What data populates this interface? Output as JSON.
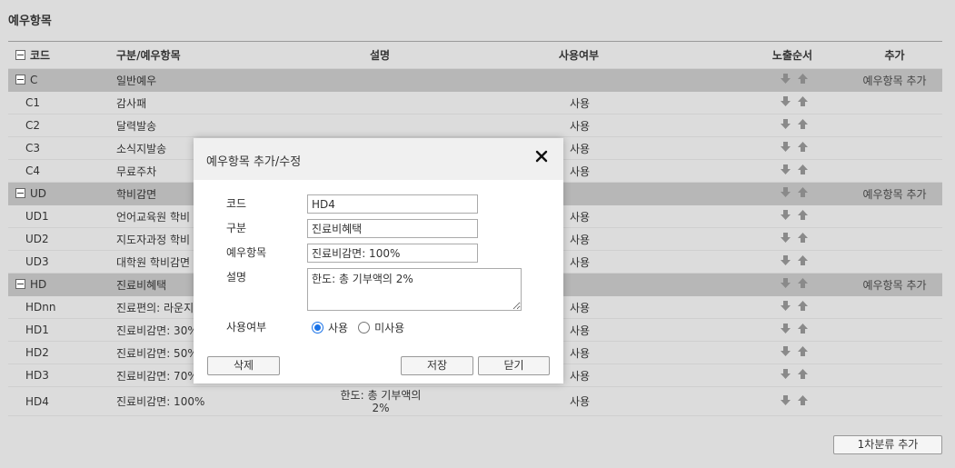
{
  "page": {
    "title": "예우항목"
  },
  "table": {
    "headers": {
      "code": "코드",
      "name": "구분/예우항목",
      "desc": "설명",
      "use": "사용여부",
      "order": "노출순서",
      "add": "추가"
    },
    "rows": [
      {
        "type": "group",
        "code": "C",
        "name": "일반예우",
        "desc": "",
        "use": "",
        "add": "예우항목 추가"
      },
      {
        "type": "item",
        "code": "C1",
        "name": "감사패",
        "desc": "",
        "use": "사용"
      },
      {
        "type": "item",
        "code": "C2",
        "name": "달력발송",
        "desc": "",
        "use": "사용"
      },
      {
        "type": "item",
        "code": "C3",
        "name": "소식지발송",
        "desc": "",
        "use": "사용"
      },
      {
        "type": "item",
        "code": "C4",
        "name": "무료주차",
        "desc": "",
        "use": "사용"
      },
      {
        "type": "group",
        "code": "UD",
        "name": "학비감면",
        "desc": "",
        "use": "",
        "add": "예우항목 추가"
      },
      {
        "type": "item",
        "code": "UD1",
        "name": "언어교육원 학비",
        "desc": "",
        "use": "사용"
      },
      {
        "type": "item",
        "code": "UD2",
        "name": "지도자과정 학비",
        "desc": "",
        "use": "사용"
      },
      {
        "type": "item",
        "code": "UD3",
        "name": "대학원 학비감면",
        "desc": "",
        "use": "사용"
      },
      {
        "type": "group",
        "code": "HD",
        "name": "진료비혜택",
        "desc": "",
        "use": "",
        "add": "예우항목 추가"
      },
      {
        "type": "item",
        "code": "HDnn",
        "name": "진료편의: 라운지",
        "desc": "",
        "use": "사용"
      },
      {
        "type": "item",
        "code": "HD1",
        "name": "진료비감면: 30%",
        "desc": "",
        "use": "사용"
      },
      {
        "type": "item",
        "code": "HD2",
        "name": "진료비감면: 50%",
        "desc": "",
        "use": "사용"
      },
      {
        "type": "item",
        "code": "HD3",
        "name": "진료비감면: 70%",
        "desc": "",
        "use": "사용"
      },
      {
        "type": "item",
        "code": "HD4",
        "name": "진료비감면: 100%",
        "desc": "한도: 총 기부액의 2%",
        "use": "사용"
      }
    ]
  },
  "footer": {
    "add_category_label": "1차분류 추가"
  },
  "modal": {
    "title": "예우항목 추가/수정",
    "labels": {
      "code": "코드",
      "category": "구분",
      "item": "예우항목",
      "desc": "설명",
      "use": "사용여부"
    },
    "values": {
      "code": "HD4",
      "category": "진료비혜택",
      "item": "진료비감면: 100%",
      "desc": "한도: 총 기부액의 2%"
    },
    "radio": {
      "on_label": "사용",
      "off_label": "미사용",
      "selected": "사용"
    },
    "buttons": {
      "delete": "삭제",
      "save": "저장",
      "close": "닫기"
    }
  },
  "colors": {
    "group_row": "#b7b7b7",
    "background": "#dcdcdc",
    "radio_accent": "#1a73e8"
  }
}
